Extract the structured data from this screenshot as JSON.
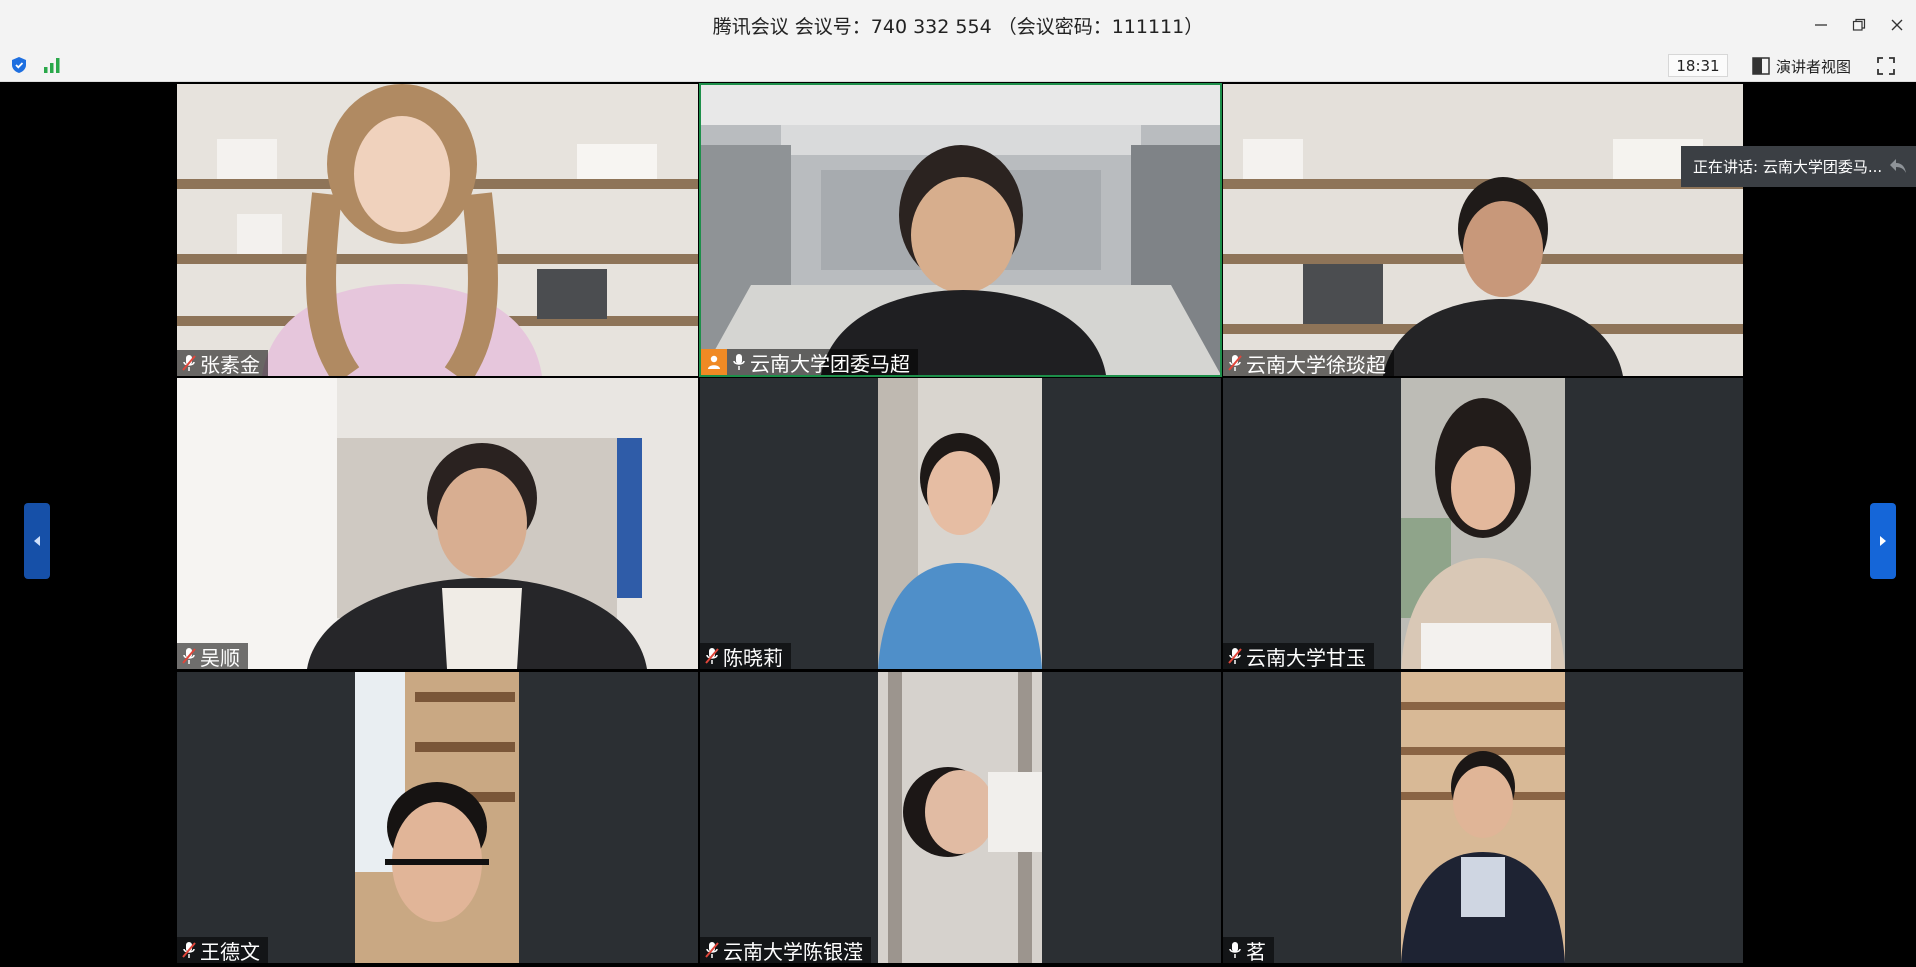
{
  "window": {
    "title": "腾讯会议 会议号：740 332 554 （会议密码：111111）"
  },
  "toolbar": {
    "time": "18:31",
    "speaker_view_label": "演讲者视图"
  },
  "speaking_banner": {
    "text": "正在讲话: 云南大学团委马..."
  },
  "participants": [
    {
      "name": "张素金",
      "mic": "muted",
      "host": false,
      "active": false,
      "scene": "shelf-office"
    },
    {
      "name": "云南大学团委马超",
      "mic": "on",
      "host": true,
      "active": true,
      "scene": "meeting-room"
    },
    {
      "name": "云南大学徐琰超",
      "mic": "muted",
      "host": false,
      "active": false,
      "scene": "shelf-office"
    },
    {
      "name": "吴顺",
      "mic": "muted",
      "host": false,
      "active": false,
      "scene": "dorm"
    },
    {
      "name": "陈晓莉",
      "mic": "muted",
      "host": false,
      "active": false,
      "scene": "portrait-room"
    },
    {
      "name": "云南大学甘玉",
      "mic": "muted",
      "host": false,
      "active": false,
      "scene": "portrait-office"
    },
    {
      "name": "王德文",
      "mic": "muted",
      "host": false,
      "active": false,
      "scene": "portrait-library"
    },
    {
      "name": "云南大学陈银滢",
      "mic": "muted",
      "host": false,
      "active": false,
      "scene": "portrait-rotated"
    },
    {
      "name": "茗",
      "mic": "on",
      "host": false,
      "active": false,
      "scene": "portrait-bookshelf"
    }
  ],
  "colors": {
    "active_border": "#1d8f4a",
    "host_badge": "#f08a24",
    "muted_icon": "#e0463b",
    "nav_arrow": "#1566d8"
  },
  "icons": {
    "shield": "shield-icon",
    "signal": "signal-icon",
    "speaker_view": "speaker-view-icon",
    "fullscreen": "fullscreen-icon",
    "minimize": "minimize-icon",
    "restore": "restore-icon",
    "close": "close-icon"
  }
}
